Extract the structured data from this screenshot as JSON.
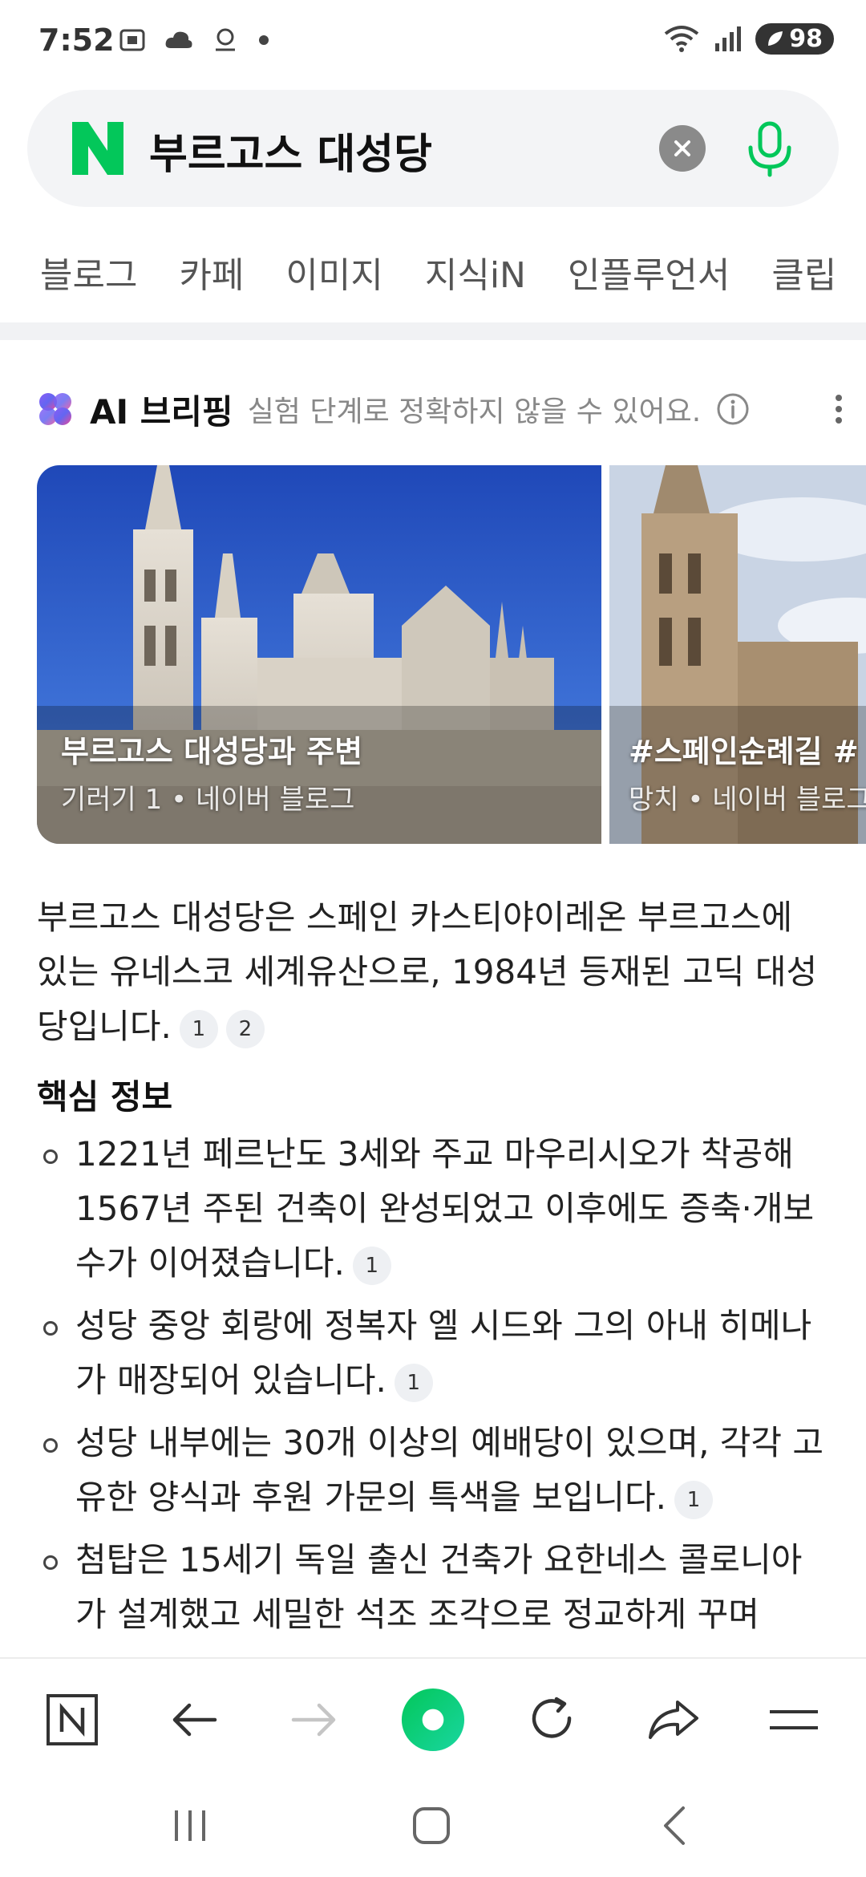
{
  "status": {
    "time": "7:52",
    "battery": "98",
    "left_icons": [
      "screenshot-icon",
      "cloud-icon",
      "alert-icon",
      "dot-icon"
    ],
    "right_icons": [
      "wifi-icon",
      "signal-icon",
      "battery-icon"
    ]
  },
  "search": {
    "logo": "N",
    "query": "부르고스 대성당"
  },
  "tabs": [
    "블로그",
    "카페",
    "이미지",
    "지식iN",
    "인플루언서",
    "클립"
  ],
  "ai_briefing": {
    "title": "AI 브리핑",
    "subtitle": "실험 단계로 정확하지 않을 수 있어요."
  },
  "cards": [
    {
      "title": "부르고스 대성당과 주변",
      "meta": "기러기 1 • 네이버 블로그"
    },
    {
      "title": "#스페인순례길 #",
      "meta": "망치 • 네이버 블로그"
    }
  ],
  "summary": {
    "text": "부르고스 대성당은 스페인 카스티야이레온 부르고스에 있는 유네스코 세계유산으로, 1984년 등재된 고딕 대성당입니다.",
    "cites": [
      "1",
      "2"
    ]
  },
  "key_info": {
    "title": "핵심 정보",
    "items": [
      {
        "text": "1221년 페르난도 3세와 주교 마우리시오가 착공해 1567년 주된 건축이 완성되었고 이후에도 증축·개보수가 이어졌습니다.",
        "cite": "1"
      },
      {
        "text": "성당 중앙 회랑에 정복자 엘 시드와 그의 아내 히메나가 매장되어 있습니다.",
        "cite": "1"
      },
      {
        "text": "성당 내부에는 30개 이상의 예배당이 있으며, 각각 고유한 양식과 후원 가문의 특색을 보입니다.",
        "cite": "1"
      },
      {
        "text": "첨탑은 15세기 독일 출신 건축가 요한네스 콜로니아가 설계했고 세밀한 석조 조각으로 정교하게 꾸며",
        "cite": ""
      }
    ]
  },
  "colors": {
    "naver_green": "#03C75A",
    "text": "#222222",
    "muted": "#888888"
  }
}
